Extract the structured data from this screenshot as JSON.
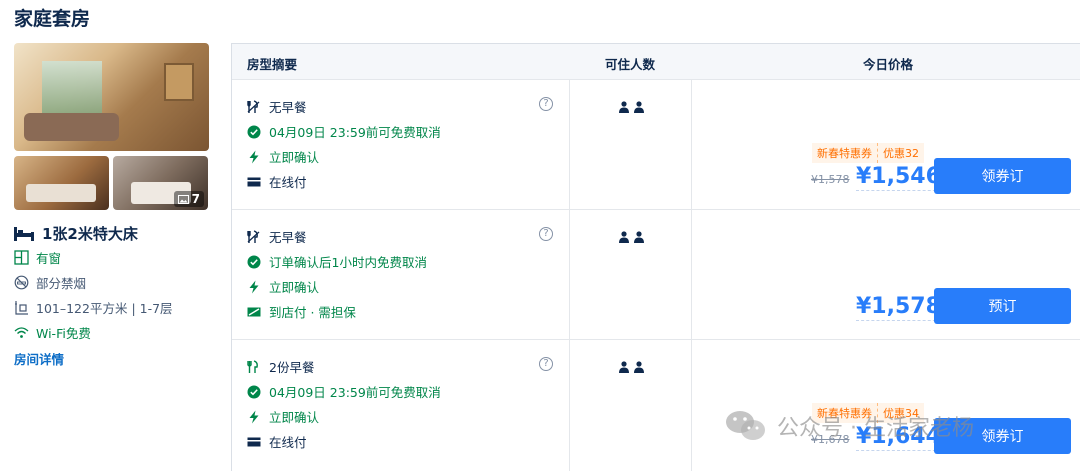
{
  "room": {
    "title": "家庭套房",
    "photo_count": "7",
    "bed_type": "1张2米特大床",
    "features": {
      "window": "有窗",
      "smoking": "部分禁烟",
      "area_floor": "101–122平方米 | 1-7层",
      "wifi": "Wi-Fi免费"
    },
    "detail_link": "房间详情"
  },
  "table": {
    "headers": {
      "summary": "房型摘要",
      "occupancy": "可住人数",
      "price": "今日价格"
    },
    "rows": [
      {
        "meal": "无早餐",
        "cancel": "04月09日 23:59前可免费取消",
        "confirm": "立即确认",
        "payment": "在线付",
        "coupon_label": "新春特惠券",
        "coupon_discount": "优惠32",
        "original_price": "¥1,578",
        "price": "¥1,546",
        "button": "领券订"
      },
      {
        "meal": "无早餐",
        "cancel": "订单确认后1小时内免费取消",
        "confirm": "立即确认",
        "payment": "到店付 · 需担保",
        "price": "¥1,578",
        "button": "预订"
      },
      {
        "meal": "2份早餐",
        "cancel": "04月09日 23:59前可免费取消",
        "confirm": "立即确认",
        "payment": "在线付",
        "coupon_label": "新春特惠券",
        "coupon_discount": "优惠34",
        "original_price": "¥1,678",
        "price": "¥1,644",
        "button": "领券订"
      }
    ]
  },
  "watermark": "公众号 · 生活家老杨",
  "colors": {
    "accent": "#287dfa",
    "green": "#00864a",
    "orange": "#ff6f00",
    "text": "#0f294d"
  }
}
